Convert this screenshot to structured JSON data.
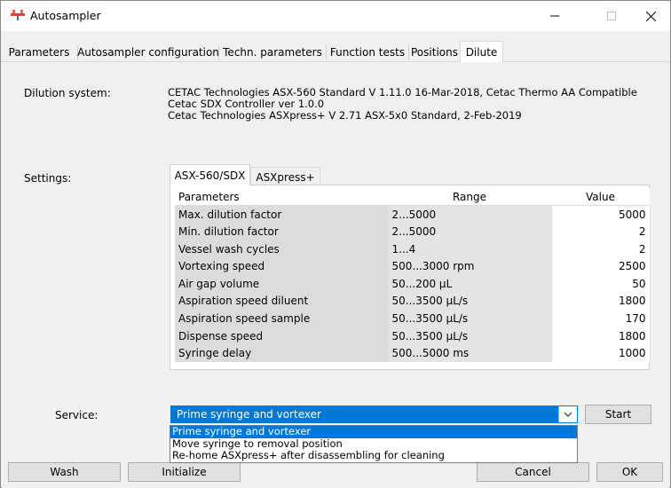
{
  "window": {
    "title": "Autosampler"
  },
  "tabs": [
    {
      "label": "Parameters"
    },
    {
      "label": "Autosampler configuration"
    },
    {
      "label": "Techn. parameters"
    },
    {
      "label": "Function tests"
    },
    {
      "label": "Positions"
    },
    {
      "label": "Dilute",
      "active": true
    }
  ],
  "dilution": {
    "label": "Dilution system:",
    "lines": [
      "CETAC Technologies ASX-560 Standard V 1.11.0 16-Mar-2018, Cetac Thermo AA Compatible",
      "Cetac SDX Controller ver 1.0.0",
      "Cetac Technologies ASXpress+ V 2.71 ASX-5x0 Standard, 2-Feb-2019"
    ]
  },
  "settings": {
    "label": "Settings:",
    "tabs": [
      "ASX-560/SDX",
      "ASXpress+"
    ],
    "columns": [
      "Parameters",
      "Range",
      "Value"
    ],
    "rows": [
      {
        "name": "Max. dilution factor",
        "range": "2...5000",
        "value": "5000"
      },
      {
        "name": "Min. dilution factor",
        "range": "2...5000",
        "value": "2"
      },
      {
        "name": "Vessel wash cycles",
        "range": "1...4",
        "value": "2"
      },
      {
        "name": "Vortexing speed",
        "range": "500...3000 rpm",
        "value": "2500"
      },
      {
        "name": "Air gap volume",
        "range": "50...200 µL",
        "value": "50"
      },
      {
        "name": "Aspiration speed diluent",
        "range": "50...3500 µL/s",
        "value": "1800"
      },
      {
        "name": "Aspiration speed sample",
        "range": "50...3500 µL/s",
        "value": "170"
      },
      {
        "name": "Dispense speed",
        "range": "50...3500 µL/s",
        "value": "1800"
      },
      {
        "name": "Syringe delay",
        "range": "500...5000 ms",
        "value": "1000"
      }
    ]
  },
  "service": {
    "label": "Service:",
    "selected": "Prime syringe and vortexer",
    "start_label": "Start",
    "options": [
      "Prime syringe and vortexer",
      "Move syringe to removal position",
      "Re-home ASXpress+  after disassembling for cleaning"
    ]
  },
  "footer": {
    "wash": "Wash",
    "initialize": "Initialize",
    "cancel": "Cancel",
    "ok": "OK"
  },
  "colors": {
    "accent": "#0078d7",
    "window_bg": "#f0f0f0"
  }
}
